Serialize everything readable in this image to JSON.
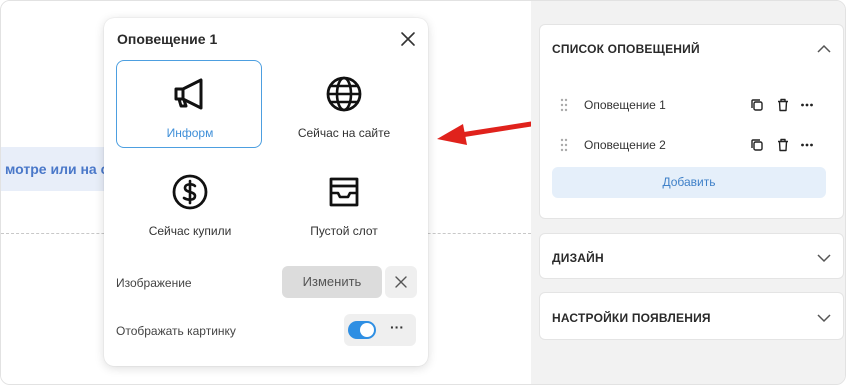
{
  "canvas": {
    "preview_text": "мотре или на с"
  },
  "popup": {
    "title": "Оповещение 1",
    "types": [
      {
        "label": "Информ",
        "icon": "megaphone-icon",
        "selected": true
      },
      {
        "label": "Сейчас на сайте",
        "icon": "globe-icon",
        "selected": false
      },
      {
        "label": "Сейчас купили",
        "icon": "dollar-icon",
        "selected": false
      },
      {
        "label": "Пустой слот",
        "icon": "inbox-icon",
        "selected": false
      }
    ],
    "image_label": "Изображение",
    "change_label": "Изменить",
    "show_image_label": "Отображать картинку",
    "show_image_enabled": true
  },
  "panel": {
    "list_section": {
      "title": "СПИСОК ОПОВЕЩЕНИЙ",
      "expanded": true,
      "items": [
        {
          "name": "Оповещение 1"
        },
        {
          "name": "Оповещение 2"
        }
      ],
      "add_label": "Добавить"
    },
    "design_section": {
      "title": "ДИЗАЙН",
      "expanded": false
    },
    "appearance_section": {
      "title": "НАСТРОЙКИ ПОЯВЛЕНИЯ",
      "expanded": false
    }
  },
  "colors": {
    "accent": "#2f8fe3",
    "selected_border": "#4d9fe0",
    "arrow": "#e0221c",
    "add_button_bg": "#e5effa"
  }
}
